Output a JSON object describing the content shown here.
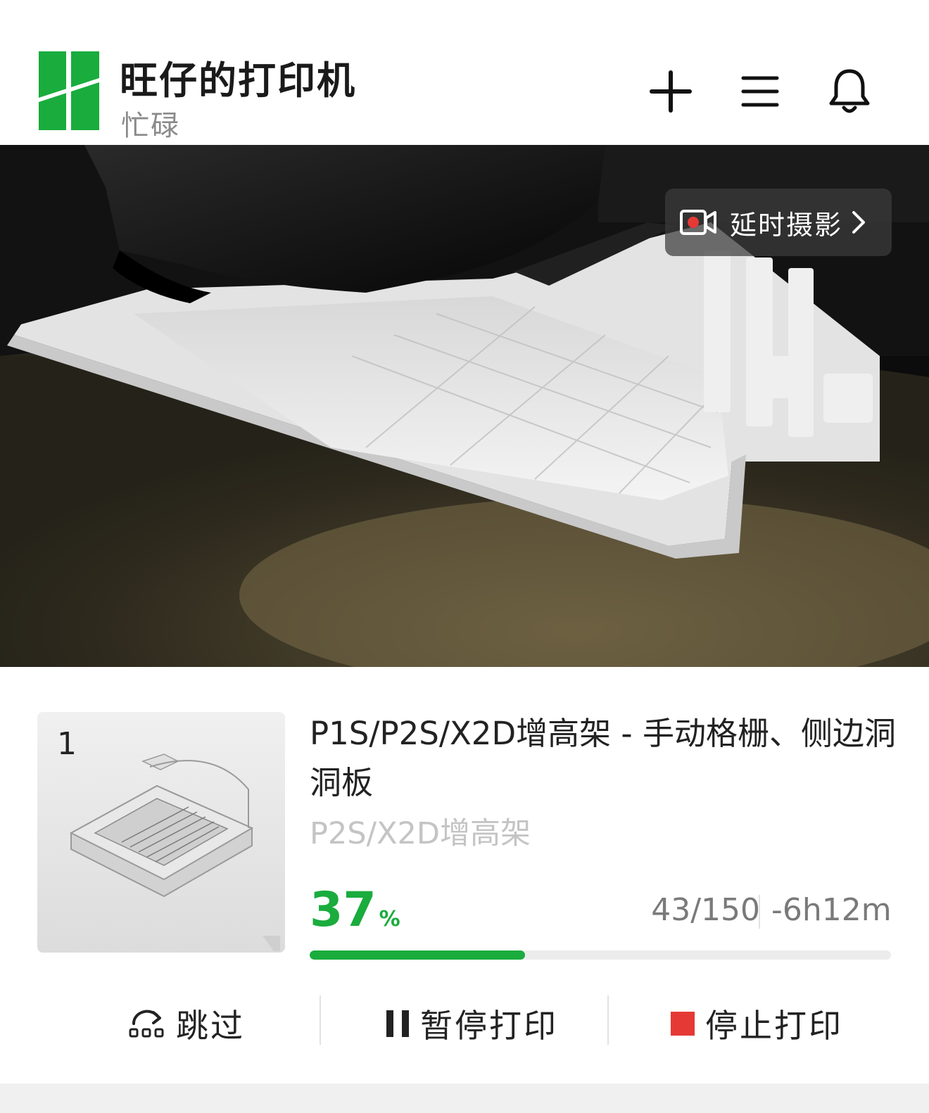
{
  "header": {
    "title": "旺仔的打印机",
    "status": "忙碌",
    "brand_color": "#1aac3d",
    "icons": [
      "add-icon",
      "menu-icon",
      "bell-icon"
    ]
  },
  "camera": {
    "timelapse_label": "延时摄影",
    "record_dot_color": "#e53935"
  },
  "job": {
    "plate_number": "1",
    "title": "P1S/P2S/X2D增高架 - 手动格栅、侧边洞洞板",
    "subtitle": "P2S/X2D增高架",
    "percent": "37",
    "percent_unit": "%",
    "progress_fraction": 0.37,
    "layers": "43/150",
    "remaining": "-6h12m"
  },
  "actions": {
    "skip_label": "跳过",
    "pause_label": "暂停打印",
    "stop_label": "停止打印",
    "stop_color": "#e53935"
  }
}
